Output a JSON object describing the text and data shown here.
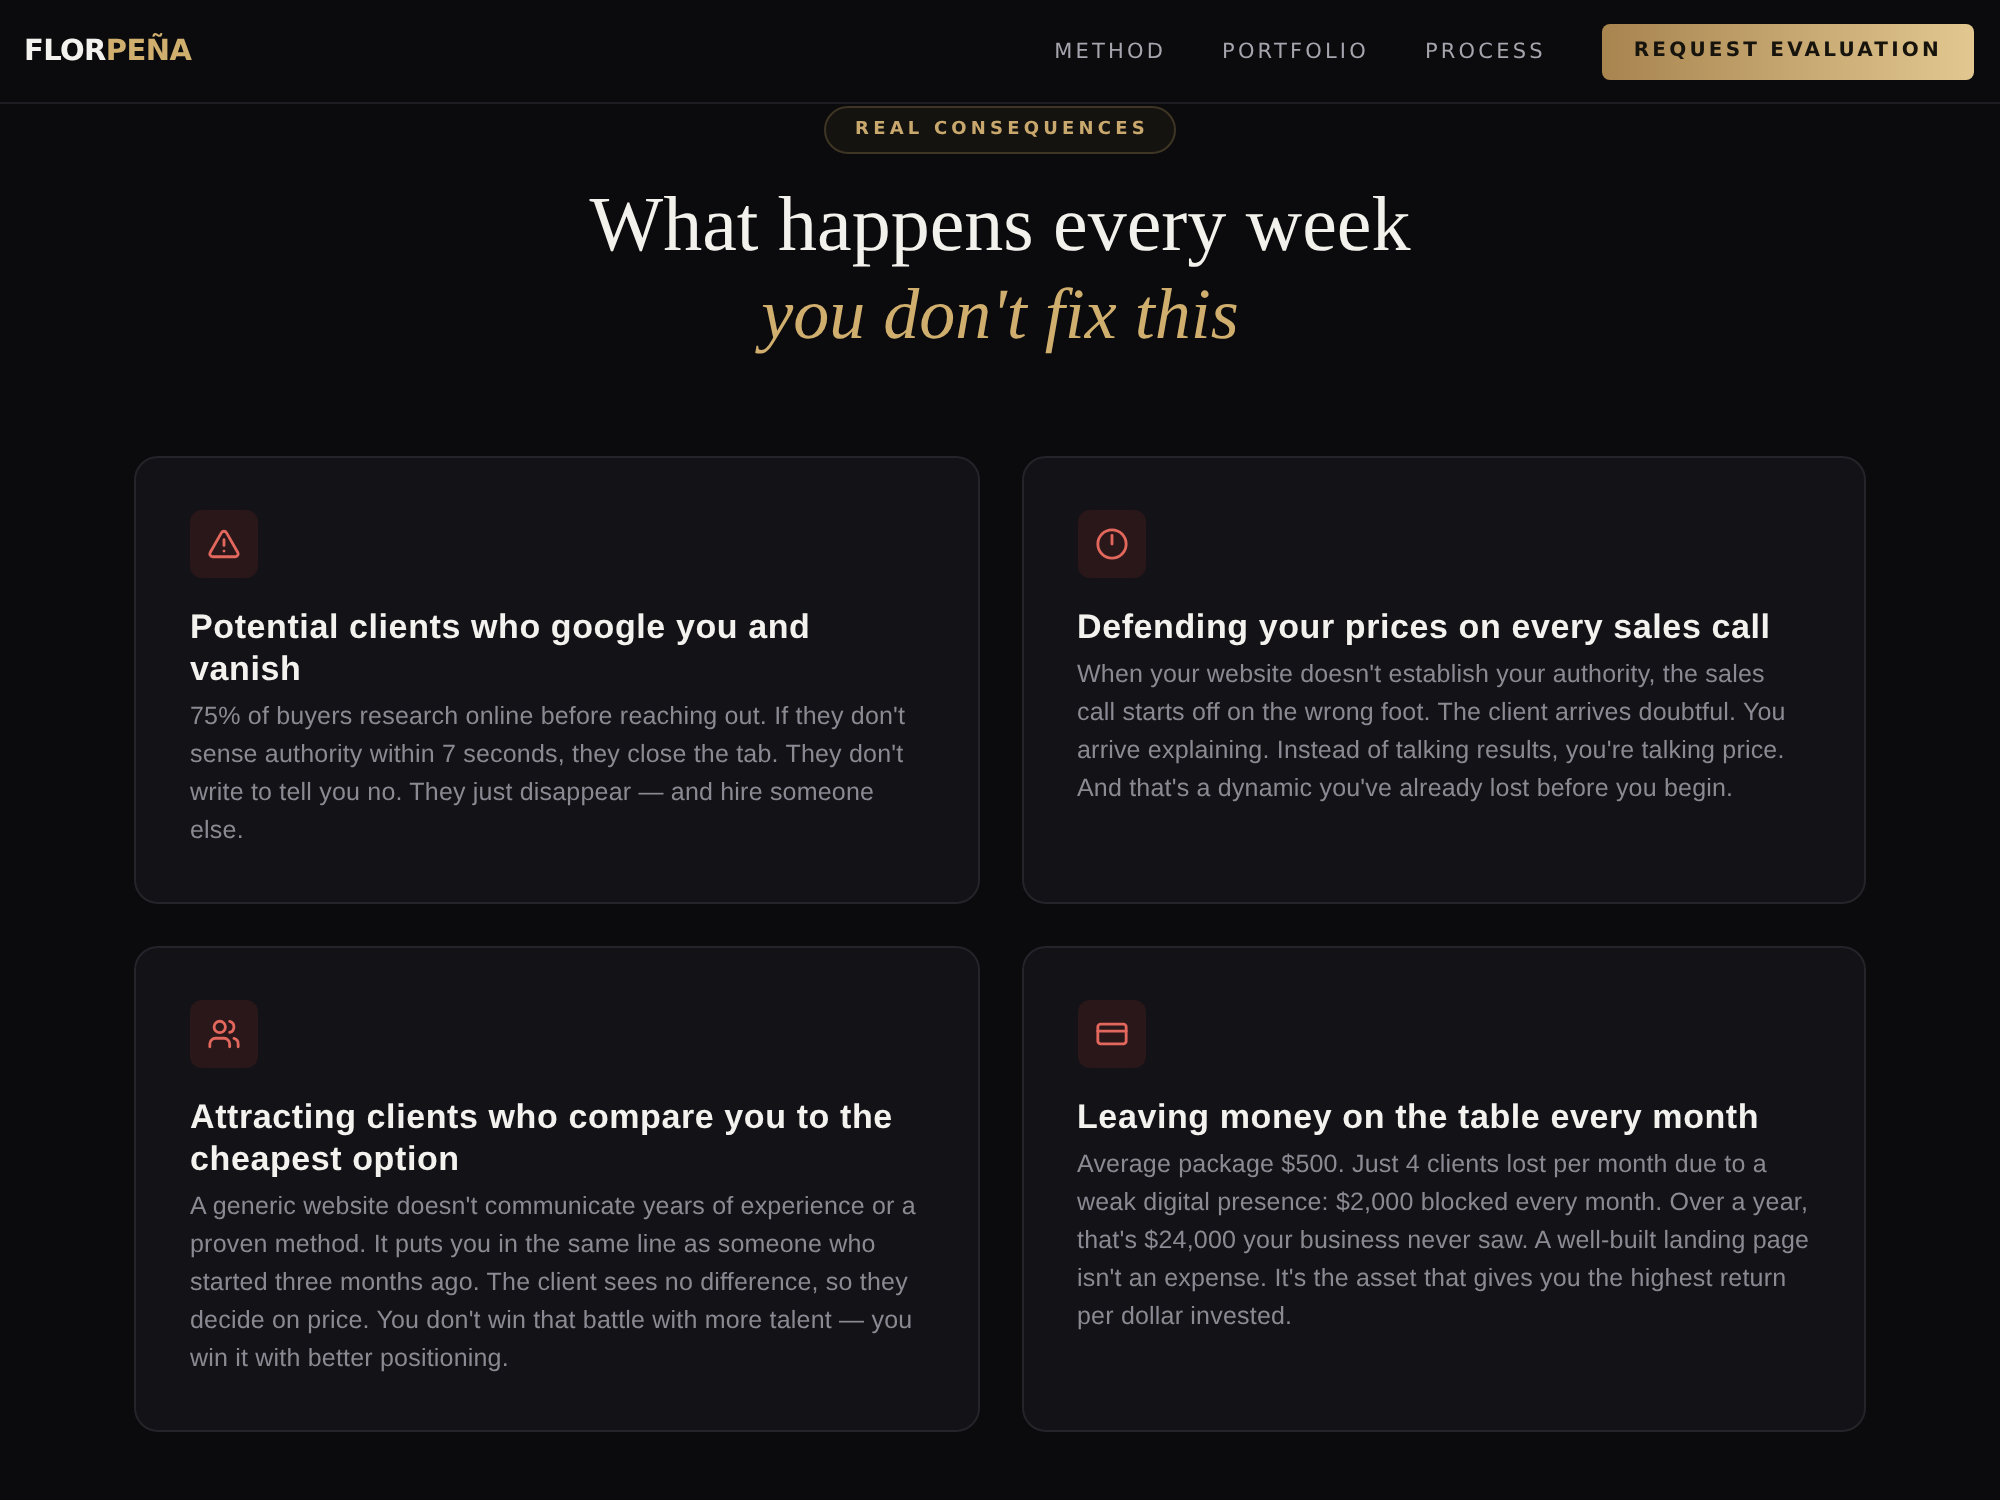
{
  "header": {
    "logo": {
      "primary": "FLOR",
      "accent": "PEÑA"
    },
    "nav": [
      "METHOD",
      "PORTFOLIO",
      "PROCESS"
    ],
    "cta": "REQUEST EVALUATION"
  },
  "section": {
    "badge": "REAL CONSEQUENCES",
    "heading": "What happens every week",
    "heading_accent": "you don't fix this",
    "cards": [
      {
        "title": "Potential clients who google you and vanish",
        "text": "75% of buyers research online before reaching out. If they don't sense authority within 7 seconds, they close the tab. They don't write to tell you no. They just disappear — and hire someone else."
      },
      {
        "title": "Defending your prices on every sales call",
        "text": "When your website doesn't establish your authority, the sales call starts off on the wrong foot. The client arrives doubtful. You arrive explaining. Instead of talking results, you're talking price. And that's a dynamic you've already lost before you begin."
      },
      {
        "title": "Attracting clients who compare you to the cheapest option",
        "text": "A generic website doesn't communicate years of experience or a proven method. It puts you in the same line as someone who started three months ago. The client sees no difference, so they decide on price. You don't win that battle with more talent — you win it with better positioning."
      },
      {
        "title": "Leaving money on the table every month",
        "text": "Average package $500. Just 4 clients lost per month due to a weak digital presence: $2,000 blocked every month. Over a year, that's $24,000 your business never saw. A well-built landing page isn't an expense. It's the asset that gives you the highest return per dollar invested."
      }
    ]
  }
}
